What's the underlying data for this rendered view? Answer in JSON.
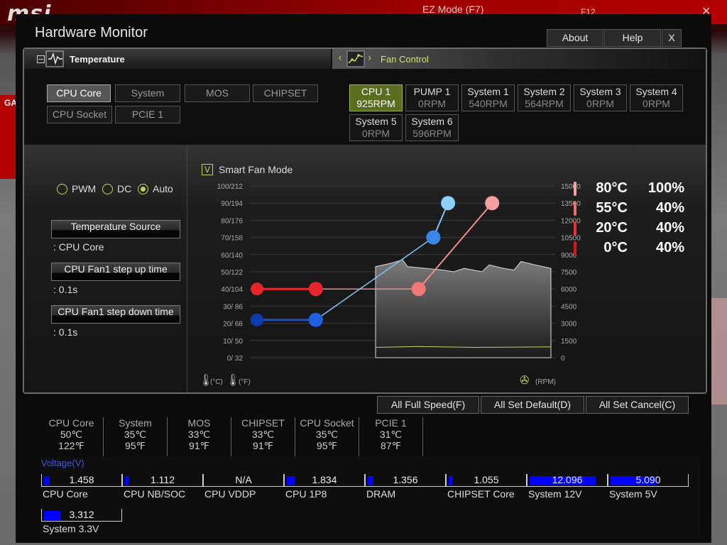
{
  "background": {
    "brand": "msi",
    "ez_mode": "EZ Mode (F7)",
    "f12": "F12",
    "left_tab": "GA"
  },
  "window": {
    "title": "Hardware Monitor",
    "about": "About",
    "help": "Help",
    "close": "X"
  },
  "tabs": {
    "temperature": "Temperature",
    "fan_control": "Fan Control"
  },
  "sensors": [
    {
      "label": "CPU Core",
      "selected": true
    },
    {
      "label": "System",
      "selected": false
    },
    {
      "label": "MOS",
      "selected": false
    },
    {
      "label": "CHIPSET",
      "selected": false
    },
    {
      "label": "CPU Socket",
      "selected": false
    },
    {
      "label": "PCIE 1",
      "selected": false
    }
  ],
  "fans": [
    {
      "name": "CPU 1",
      "rpm": "925RPM",
      "selected": true
    },
    {
      "name": "PUMP 1",
      "rpm": "0RPM",
      "selected": false
    },
    {
      "name": "System 1",
      "rpm": "540RPM",
      "selected": false
    },
    {
      "name": "System 2",
      "rpm": "564RPM",
      "selected": false
    },
    {
      "name": "System 3",
      "rpm": "0RPM",
      "selected": false
    },
    {
      "name": "System 4",
      "rpm": "0RPM",
      "selected": false
    },
    {
      "name": "System 5",
      "rpm": "0RPM",
      "selected": false
    },
    {
      "name": "System 6",
      "rpm": "596RPM",
      "selected": false
    }
  ],
  "mode": {
    "options": [
      "PWM",
      "DC",
      "Auto"
    ],
    "selected": "Auto"
  },
  "temp_source": {
    "label": "Temperature Source",
    "value": ": CPU Core"
  },
  "step_up": {
    "label": "CPU Fan1 step up time",
    "value": ": 0.1s"
  },
  "step_down": {
    "label": "CPU Fan1 step down time",
    "value": ": 0.1s"
  },
  "smart_fan": {
    "label": "Smart Fan Mode",
    "checked": true,
    "check_mark": "V"
  },
  "chart_data": {
    "type": "line",
    "left_ticks": [
      "100/212",
      "90/194",
      "80/176",
      "70/158",
      "60/140",
      "50/122",
      "40/104",
      "30/ 86",
      "20/ 68",
      "10/ 50",
      "0/ 32"
    ],
    "right_ticks": [
      "15000",
      "13500",
      "12000",
      "10500",
      "9000",
      "7500",
      "6000",
      "4500",
      "3000",
      "1500",
      "0"
    ],
    "left_unit_c": "(°C)",
    "left_unit_f": "(°F)",
    "right_unit": "(RPM)",
    "curves": [
      {
        "name": "red",
        "color": "#e8262a",
        "light_color": "#f58a8a",
        "points": [
          [
            0,
            40
          ],
          [
            20,
            40
          ],
          [
            55,
            40
          ],
          [
            80,
            90
          ]
        ]
      },
      {
        "name": "blue",
        "color": "#1f4fd0",
        "light_color": "#7ec3f7",
        "points": [
          [
            0,
            22
          ],
          [
            20,
            22
          ],
          [
            60,
            70
          ],
          [
            65,
            90
          ]
        ]
      }
    ]
  },
  "legend": [
    {
      "temp": "80°C",
      "pct": "100%",
      "color": "#f6a5a5"
    },
    {
      "temp": "55°C",
      "pct": "40%",
      "color": "#f06b6b"
    },
    {
      "temp": "20°C",
      "pct": "40%",
      "color": "#e83030"
    },
    {
      "temp": "0°C",
      "pct": "40%",
      "color": "#e01010"
    }
  ],
  "actions": {
    "full_speed": "All Full Speed(F)",
    "set_default": "All Set Default(D)",
    "set_cancel": "All Set Cancel(C)"
  },
  "readings": [
    {
      "name": "CPU Core",
      "c": "50℃",
      "f": "122℉"
    },
    {
      "name": "System",
      "c": "35℃",
      "f": "95℉"
    },
    {
      "name": "MOS",
      "c": "33℃",
      "f": "91℉"
    },
    {
      "name": "CHIPSET",
      "c": "33℃",
      "f": "91℉"
    },
    {
      "name": "CPU Socket",
      "c": "35℃",
      "f": "95℉"
    },
    {
      "name": "PCIE 1",
      "c": "31℃",
      "f": "87℉"
    }
  ],
  "voltage": {
    "title": "Voltage(V)",
    "items": [
      {
        "name": "CPU Core",
        "value": "1.458",
        "fill": 0.07
      },
      {
        "name": "CPU NB/SOC",
        "value": "1.112",
        "fill": 0.05
      },
      {
        "name": "CPU VDDP",
        "value": "N/A",
        "fill": 0
      },
      {
        "name": "CPU 1P8",
        "value": "1.834",
        "fill": 0.1
      },
      {
        "name": "DRAM",
        "value": "1.356",
        "fill": 0.07
      },
      {
        "name": "CHIPSET Core",
        "value": "1.055",
        "fill": 0.05
      },
      {
        "name": "System 12V",
        "value": "12.096",
        "fill": 0.86
      },
      {
        "name": "System 5V",
        "value": "5.090",
        "fill": 0.6
      },
      {
        "name": "System 3.3V",
        "value": "3.312",
        "fill": 0.21
      }
    ]
  }
}
